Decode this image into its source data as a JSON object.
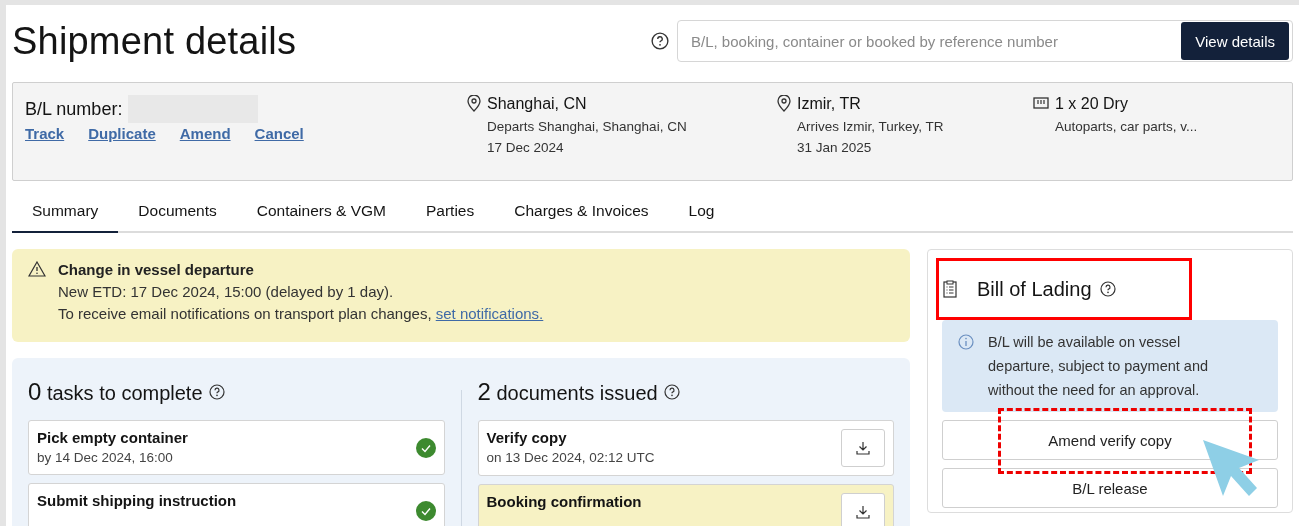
{
  "page": {
    "title": "Shipment details"
  },
  "search": {
    "placeholder": "B/L, booking, container or booked by reference number",
    "button": "View details"
  },
  "summary": {
    "bl_label": "B/L number:",
    "actions": [
      "Track",
      "Duplicate",
      "Amend",
      "Cancel"
    ],
    "origin": {
      "city": "Shanghai, CN",
      "detail": "Departs Shanghai, Shanghai, CN",
      "date": "17 Dec 2024"
    },
    "destination": {
      "city": "Izmir, TR",
      "detail": "Arrives Izmir, Turkey, TR",
      "date": "31 Jan 2025"
    },
    "cargo": {
      "equipment": "1 x 20 Dry",
      "commodity": "Autoparts, car parts, v..."
    }
  },
  "tabs": [
    {
      "label": "Summary",
      "selected": true
    },
    {
      "label": "Documents",
      "selected": false
    },
    {
      "label": "Containers & VGM",
      "selected": false
    },
    {
      "label": "Parties",
      "selected": false
    },
    {
      "label": "Charges & Invoices",
      "selected": false
    },
    {
      "label": "Log",
      "selected": false
    }
  ],
  "alert": {
    "title": "Change in vessel departure",
    "line": "New ETD: 17 Dec 2024, 15:00 (delayed by 1 day).",
    "notice": "To receive email notifications on transport plan changes,",
    "link": "set notifications."
  },
  "tasks": {
    "count": "0",
    "heading": "tasks to complete",
    "items": [
      {
        "title": "Pick empty container",
        "due": "by 14 Dec 2024, 16:00",
        "done": true
      },
      {
        "title": "Submit shipping instruction",
        "done": true
      }
    ]
  },
  "documents": {
    "count": "2",
    "heading": "documents issued",
    "items": [
      {
        "title": "Verify copy",
        "date": "on 13 Dec 2024, 02:12 UTC",
        "highlighted": false
      },
      {
        "title": "Booking confirmation",
        "highlighted": true
      }
    ]
  },
  "bill_of_lading": {
    "title": "Bill of Lading",
    "annotated": true,
    "info": "B/L will be available on vessel departure, subject to payment and without the need for an approval.",
    "buttons": [
      {
        "label": "Amend verify copy",
        "annotated": true
      },
      {
        "label": "B/L release",
        "annotated": false
      }
    ]
  }
}
